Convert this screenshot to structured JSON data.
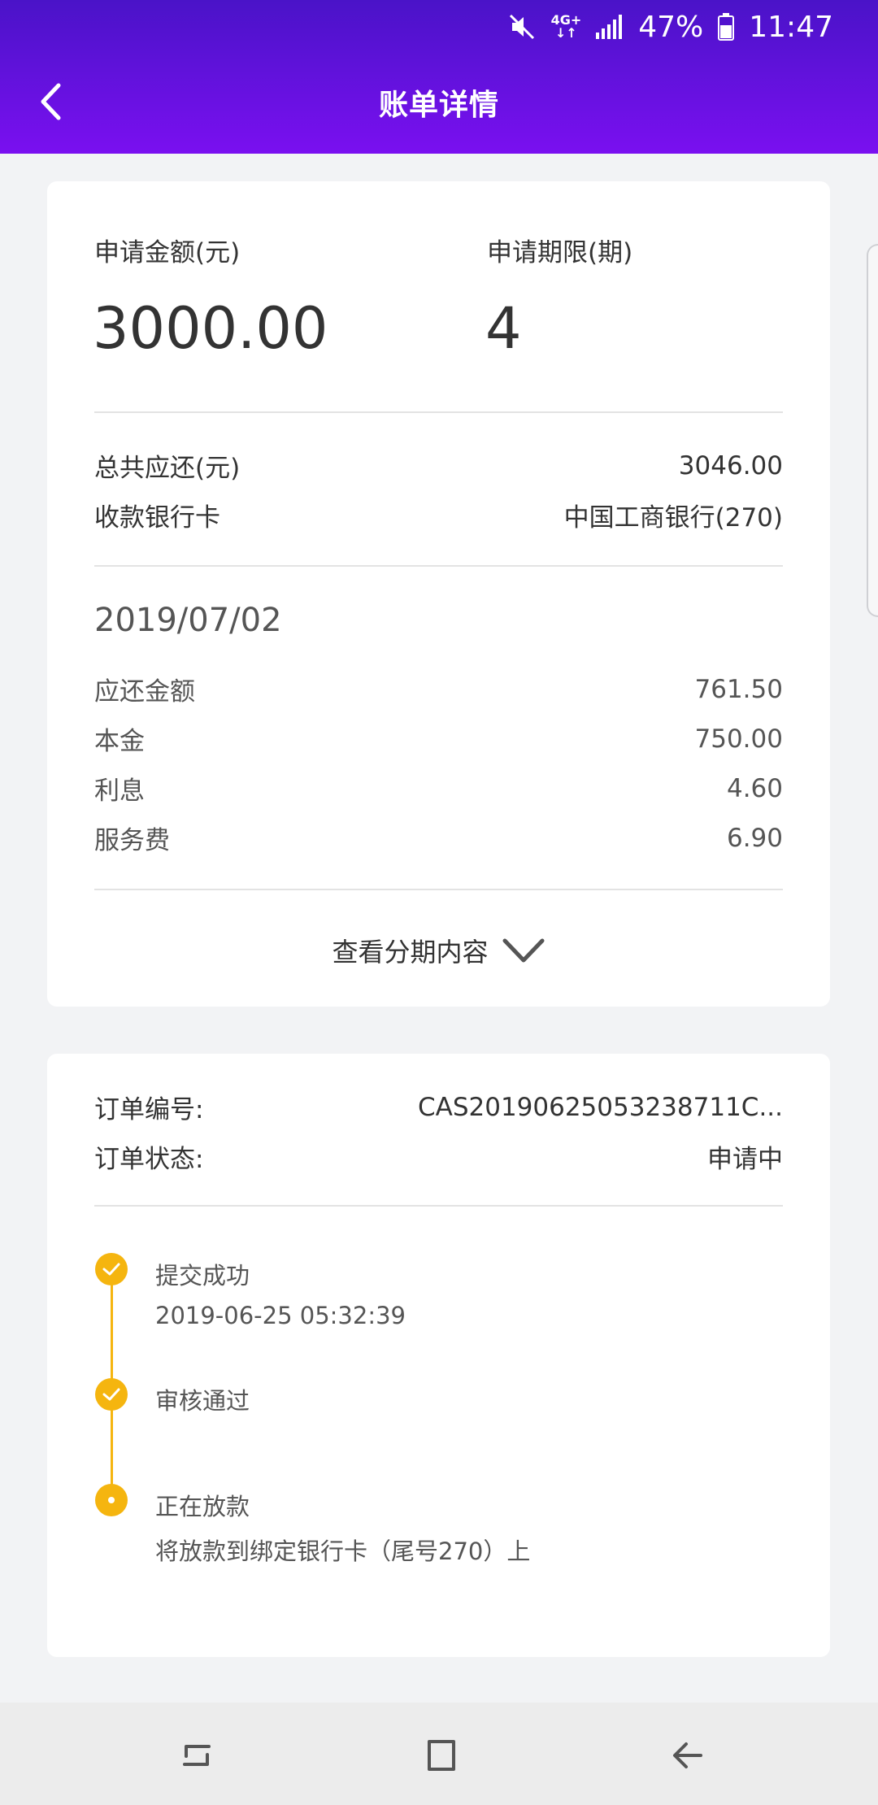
{
  "status_bar": {
    "network": "4G+",
    "battery_percent": "47%",
    "time": "11:47",
    "icons": [
      "mute-icon",
      "network-4g-icon",
      "signal-icon",
      "battery-icon"
    ]
  },
  "header": {
    "title": "账单详情",
    "back_icon": "chevron-left-icon"
  },
  "summary": {
    "apply_amount_label": "申请金额(元)",
    "apply_amount_value": "3000.00",
    "apply_term_label": "申请期限(期)",
    "apply_term_value": "4",
    "total_repay_label": "总共应还(元)",
    "total_repay_value": "3046.00",
    "bank_card_label": "收款银行卡",
    "bank_card_value": "中国工商银行(270)"
  },
  "installment": {
    "date": "2019/07/02",
    "rows": [
      {
        "label": "应还金额",
        "value": "761.50"
      },
      {
        "label": "本金",
        "value": "750.00"
      },
      {
        "label": "利息",
        "value": "4.60"
      },
      {
        "label": "服务费",
        "value": "6.90"
      }
    ],
    "expand_label": "查看分期内容",
    "expand_icon": "chevron-down-icon"
  },
  "order": {
    "number_label": "订单编号:",
    "number_value": "CAS20190625053238711C...",
    "status_label": "订单状态:",
    "status_value": "申请中",
    "timeline": [
      {
        "title": "提交成功",
        "detail": "2019-06-25 05:32:39",
        "state": "done"
      },
      {
        "title": "审核通过",
        "detail": "",
        "state": "done"
      },
      {
        "title": "正在放款",
        "detail": "将放款到绑定银行卡（尾号270）上",
        "state": "current"
      }
    ]
  },
  "colors": {
    "header_top": "#4a13c8",
    "header_bottom": "#7a10f0",
    "timeline_accent": "#f5b50f"
  },
  "nav_bar": {
    "icons": [
      "recent-apps-icon",
      "home-icon",
      "back-icon"
    ]
  }
}
